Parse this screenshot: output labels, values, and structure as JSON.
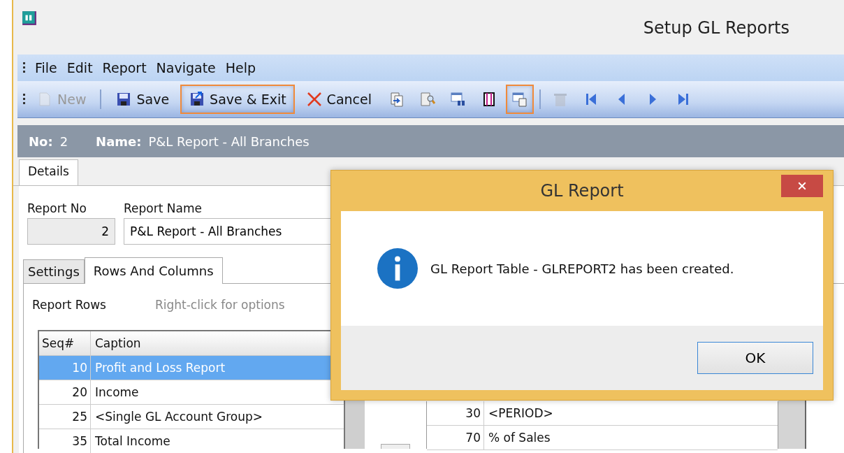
{
  "window": {
    "title": "Setup GL Reports"
  },
  "menu": [
    {
      "label": "File"
    },
    {
      "label": "Edit"
    },
    {
      "label": "Report"
    },
    {
      "label": "Navigate"
    },
    {
      "label": "Help"
    }
  ],
  "toolbar": [
    {
      "kind": "new",
      "label": "New",
      "disabled": true,
      "highlighted": false
    },
    {
      "kind": "save",
      "label": "Save",
      "disabled": false,
      "highlighted": false
    },
    {
      "kind": "save-exit",
      "label": "Save & Exit",
      "disabled": false,
      "highlighted": true
    },
    {
      "kind": "cancel",
      "label": "Cancel",
      "disabled": false,
      "highlighted": false
    },
    {
      "kind": "doc-arrow",
      "disabled": false,
      "highlighted": false
    },
    {
      "kind": "doc-search",
      "disabled": false,
      "highlighted": false
    },
    {
      "kind": "table-binoculars",
      "disabled": false,
      "highlighted": false
    },
    {
      "kind": "columns",
      "disabled": false,
      "highlighted": false
    },
    {
      "kind": "table-copy",
      "disabled": false,
      "highlighted": true
    },
    {
      "kind": "trash",
      "disabled": true,
      "highlighted": false
    },
    {
      "kind": "first",
      "disabled": false,
      "highlighted": false
    },
    {
      "kind": "prev",
      "disabled": false,
      "highlighted": false
    },
    {
      "kind": "next",
      "disabled": false,
      "highlighted": false
    },
    {
      "kind": "last",
      "disabled": false,
      "highlighted": false
    }
  ],
  "header": {
    "no_label": "No:",
    "no": "2",
    "name_label": "Name:",
    "name": "P&L Report - All Branches"
  },
  "tabs": [
    {
      "label": "Details",
      "selected": true
    }
  ],
  "fields": {
    "report_no_label": "Report No",
    "report_no": "2",
    "report_name_label": "Report Name",
    "report_name": "P&L Report - All Branches"
  },
  "subtabs": [
    {
      "label": "Settings",
      "selected": false
    },
    {
      "label": "Rows And Columns",
      "selected": true
    }
  ],
  "rows_panel": {
    "title": "Report Rows",
    "hint": "Right-click for options"
  },
  "rows_table": {
    "columns": [
      "Seq#",
      "Caption"
    ],
    "rows": [
      {
        "seq": "10",
        "caption": "Profit and Loss Report",
        "selected": true
      },
      {
        "seq": "20",
        "caption": "Income",
        "selected": false
      },
      {
        "seq": "25",
        "caption": "<Single GL Account Group>",
        "selected": false
      },
      {
        "seq": "35",
        "caption": "Total Income",
        "selected": false
      }
    ]
  },
  "columns_table": {
    "rows": [
      {
        "seq": "30",
        "caption": "<PERIOD>"
      },
      {
        "seq": "70",
        "caption": "% of Sales"
      }
    ]
  },
  "dialog": {
    "title": "GL Report",
    "message": "GL Report Table - GLREPORT2 has been created.",
    "buttons": [
      "OK"
    ]
  }
}
